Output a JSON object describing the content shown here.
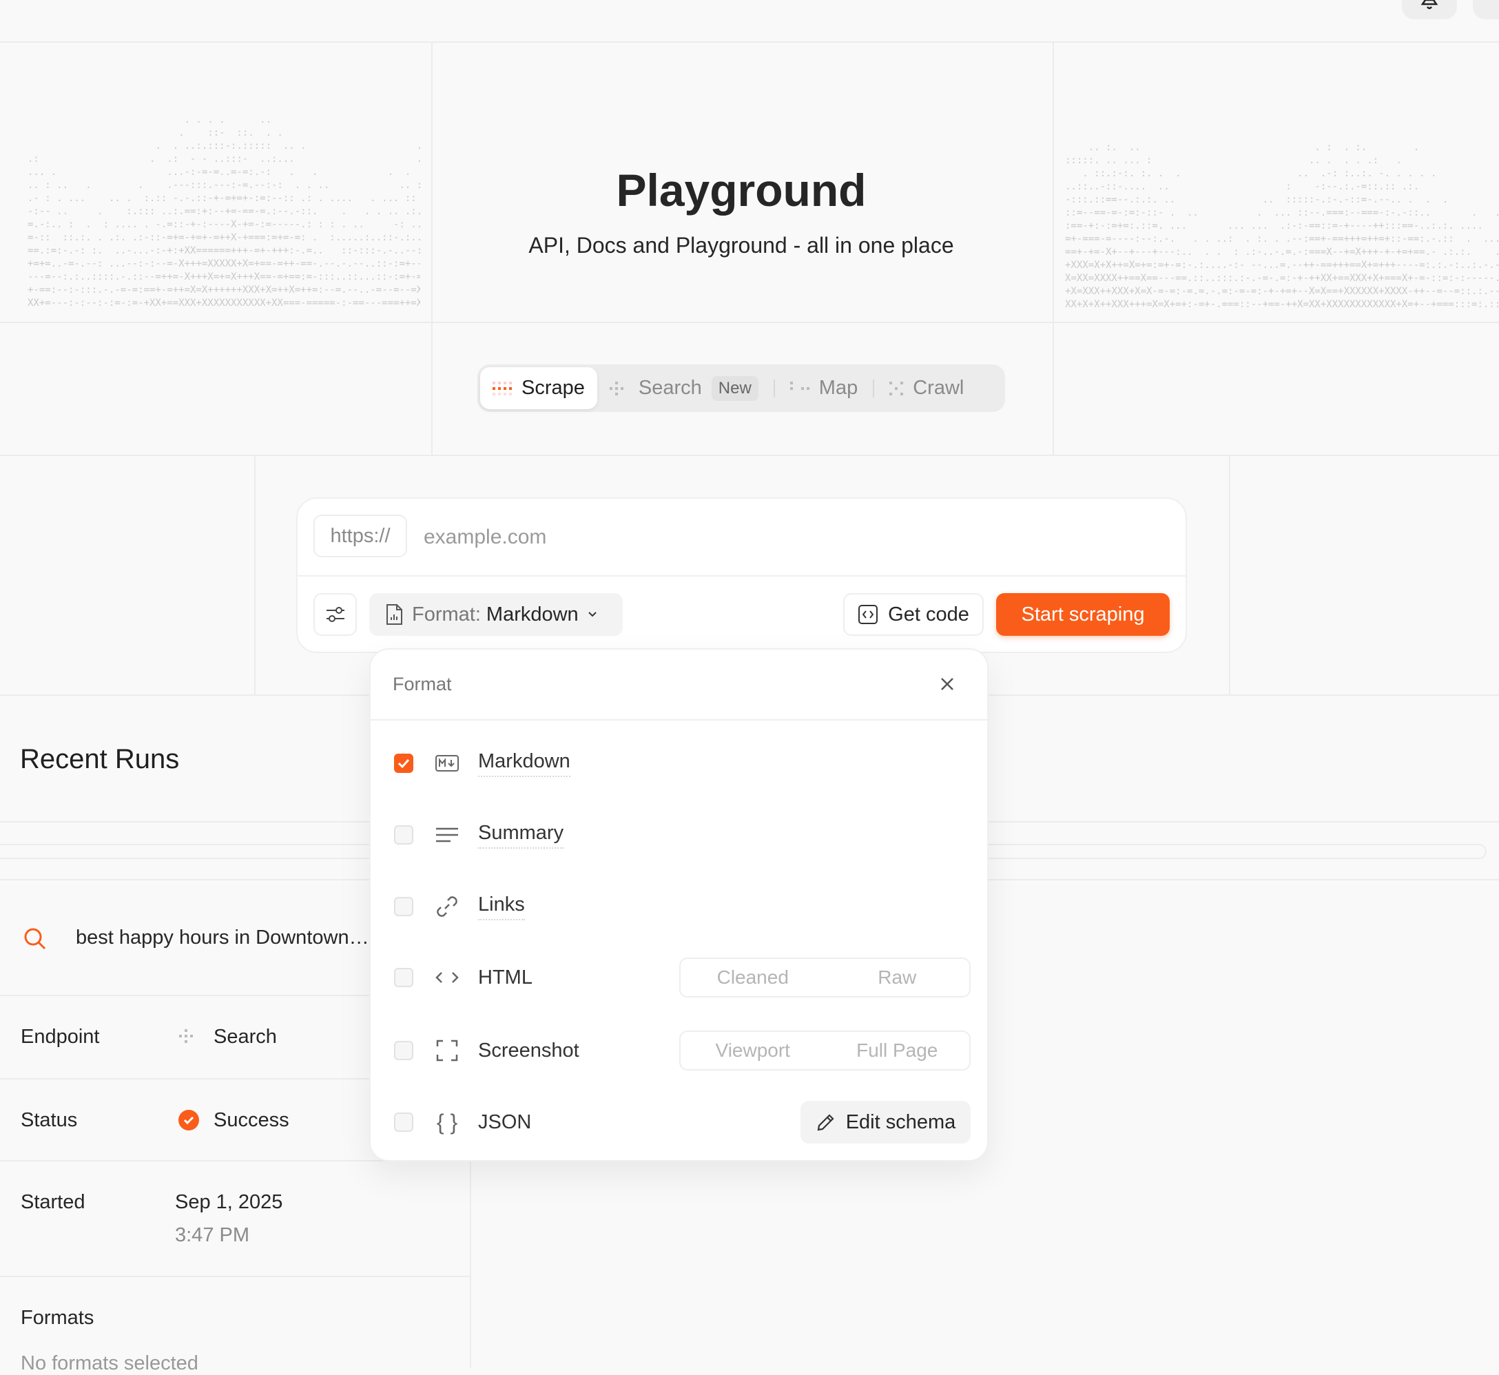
{
  "hero": {
    "title": "Playground",
    "subtitle": "API, Docs and Playground - all in one place"
  },
  "tabs": [
    {
      "label": "Scrape",
      "active": true
    },
    {
      "label": "Search",
      "badge": "New"
    },
    {
      "label": "Map"
    },
    {
      "label": "Crawl"
    }
  ],
  "url_input": {
    "prefix": "https://",
    "placeholder": "example.com",
    "value": ""
  },
  "toolbar": {
    "format_prefix": "Format:",
    "format_value": "Markdown",
    "get_code": "Get code",
    "start": "Start scraping"
  },
  "format_popup": {
    "title": "Format",
    "items": [
      {
        "label": "Markdown",
        "checked": true
      },
      {
        "label": "Summary",
        "checked": false
      },
      {
        "label": "Links",
        "checked": false
      },
      {
        "label": "HTML",
        "checked": false,
        "options": [
          "Cleaned",
          "Raw"
        ]
      },
      {
        "label": "Screenshot",
        "checked": false,
        "options": [
          "Viewport",
          "Full Page"
        ]
      },
      {
        "label": "JSON",
        "checked": false,
        "action": "Edit schema"
      }
    ]
  },
  "recent_runs": {
    "title": "Recent Runs",
    "query": "best happy hours in Downtown…",
    "endpoint_label": "Endpoint",
    "endpoint_value": "Search",
    "status_label": "Status",
    "status_value": "Success",
    "started_label": "Started",
    "started_date": "Sep 1, 2025",
    "started_time": "3:47 PM",
    "formats_label": "Formats",
    "formats_value": "No formats selected"
  },
  "colors": {
    "accent": "#fa5d19",
    "background": "#f9f9f9"
  }
}
